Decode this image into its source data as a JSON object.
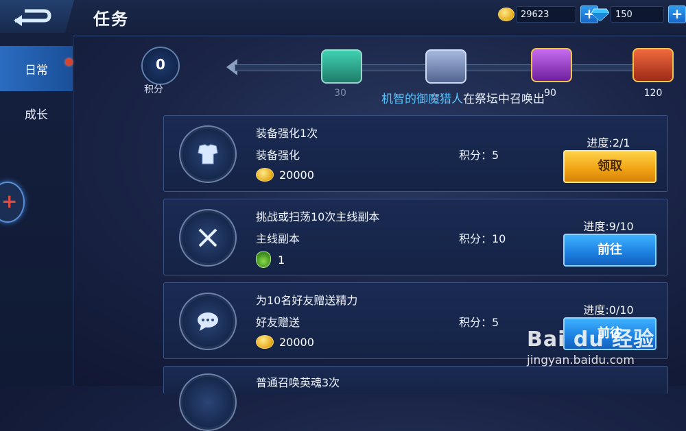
{
  "header": {
    "title": "任务"
  },
  "currency": {
    "gold": "29623",
    "gems": "150",
    "plus_symbol": "+"
  },
  "sidebar": {
    "tabs": [
      {
        "label": "日常"
      },
      {
        "label": "成长"
      }
    ]
  },
  "score": {
    "value": "0",
    "label": "积分"
  },
  "milestones": [
    {
      "value": "30",
      "chest": "teal-chest-icon",
      "color": "#2ba38d"
    },
    {
      "value": "",
      "chest": "silver-chest-icon",
      "color": "#7d93c4"
    },
    {
      "value": "90",
      "chest": "purple-chest-icon",
      "color": "#9a3bc8"
    },
    {
      "value": "120",
      "chest": "red-chest-icon",
      "color": "#d1472b"
    }
  ],
  "announcement": {
    "highlight": "机智的御魔猎人",
    "rest": "在祭坛中召唤出"
  },
  "tasks": [
    {
      "title": "装备强化1次",
      "category": "装备强化",
      "reward": "20000",
      "reward_icon": "coin-icon",
      "points": "积分：5",
      "progress": "进度:2/1",
      "button": "领取",
      "button_style": "gold",
      "icon": "armor-icon"
    },
    {
      "title": "挑战或扫荡10次主线副本",
      "category": "主线副本",
      "reward": "1",
      "reward_icon": "potion-icon",
      "points": "积分：10",
      "progress": "进度:9/10",
      "button": "前往",
      "button_style": "blue",
      "icon": "crossed-swords-icon"
    },
    {
      "title": "为10名好友赠送精力",
      "category": "好友赠送",
      "reward": "20000",
      "reward_icon": "coin-icon",
      "points": "积分：5",
      "progress": "进度:0/10",
      "button": "前往",
      "button_style": "blue",
      "icon": "chat-bubble-icon"
    },
    {
      "title": "普通召唤英魂3次",
      "category": "",
      "reward": "",
      "reward_icon": "",
      "points": "",
      "progress": "",
      "button": "",
      "button_style": "",
      "icon": "summon-icon"
    }
  ],
  "watermark": {
    "brand": "Bai du 经验",
    "url": "jingyan.baidu.com"
  }
}
